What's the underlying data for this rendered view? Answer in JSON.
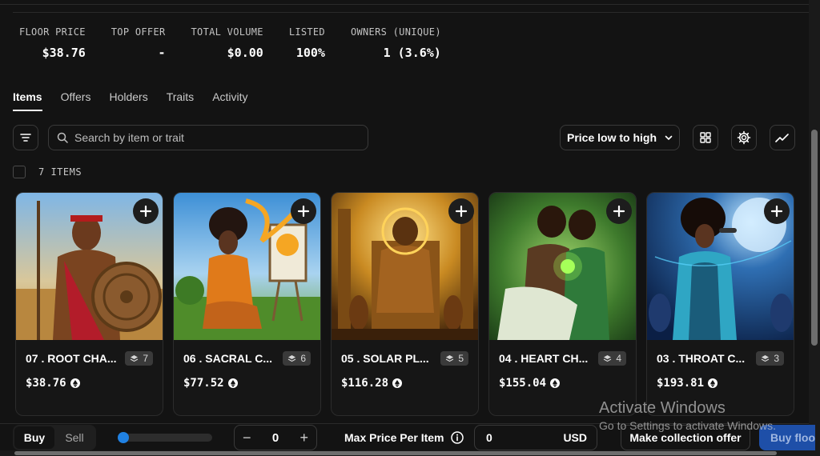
{
  "stats": [
    {
      "label": "FLOOR PRICE",
      "value": "$38.76"
    },
    {
      "label": "TOP OFFER",
      "value": "-"
    },
    {
      "label": "TOTAL VOLUME",
      "value": "$0.00"
    },
    {
      "label": "LISTED",
      "value": "100%"
    },
    {
      "label": "OWNERS (UNIQUE)",
      "value": "1 (3.6%)"
    }
  ],
  "tabs": [
    {
      "label": "Items",
      "active": true
    },
    {
      "label": "Offers"
    },
    {
      "label": "Holders"
    },
    {
      "label": "Traits"
    },
    {
      "label": "Activity"
    }
  ],
  "search": {
    "placeholder": "Search by item or trait"
  },
  "sort": {
    "label": "Price low to high"
  },
  "items_count": "7 ITEMS",
  "cards": [
    {
      "name": "07 . ROOT CHA...",
      "qty": "7",
      "price": "$38.76",
      "theme": "root"
    },
    {
      "name": "06 . SACRAL C...",
      "qty": "6",
      "price": "$77.52",
      "theme": "sacral"
    },
    {
      "name": "05 . SOLAR PL...",
      "qty": "5",
      "price": "$116.28",
      "theme": "solar"
    },
    {
      "name": "04 . HEART CH...",
      "qty": "4",
      "price": "$155.04",
      "theme": "heart"
    },
    {
      "name": "03 . THROAT C...",
      "qty": "3",
      "price": "$193.81",
      "theme": "throat"
    }
  ],
  "bottom": {
    "buy": "Buy",
    "sell": "Sell",
    "quantity": "0",
    "minus": "−",
    "plus": "+",
    "max_price_label": "Max Price Per Item",
    "price_value": "0",
    "currency": "USD",
    "make_offer": "Make collection offer",
    "buy_floor": "Buy floor"
  },
  "watermark": {
    "title": "Activate Windows",
    "subtitle": "Go to Settings to activate Windows."
  },
  "colors": {
    "accent": "#2081e2",
    "background": "#131313"
  }
}
